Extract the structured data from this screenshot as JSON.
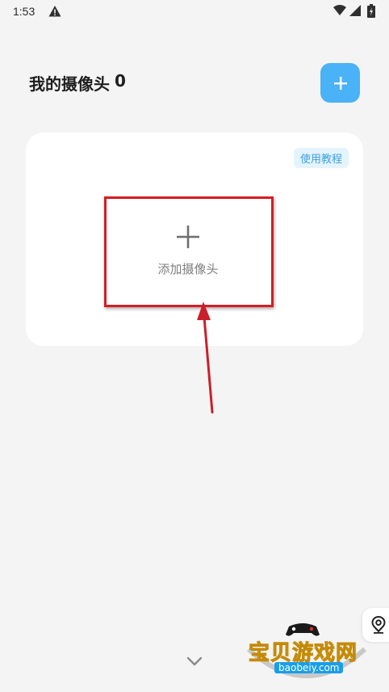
{
  "status_bar": {
    "time": "1:53"
  },
  "header": {
    "title": "我的摄像头",
    "camera_count": "0",
    "add_icon": "plus-icon"
  },
  "camera_card": {
    "tutorial_label": "使用教程",
    "add_camera_label": "添加摄像头",
    "add_icon": "plus-icon"
  },
  "watermark": {
    "brand": "宝贝游戏网",
    "domain": "baobeiy.com"
  },
  "colors": {
    "background": "#f4f4f4",
    "accent": "#4ab2f6",
    "annotation_red": "#d51d24"
  }
}
